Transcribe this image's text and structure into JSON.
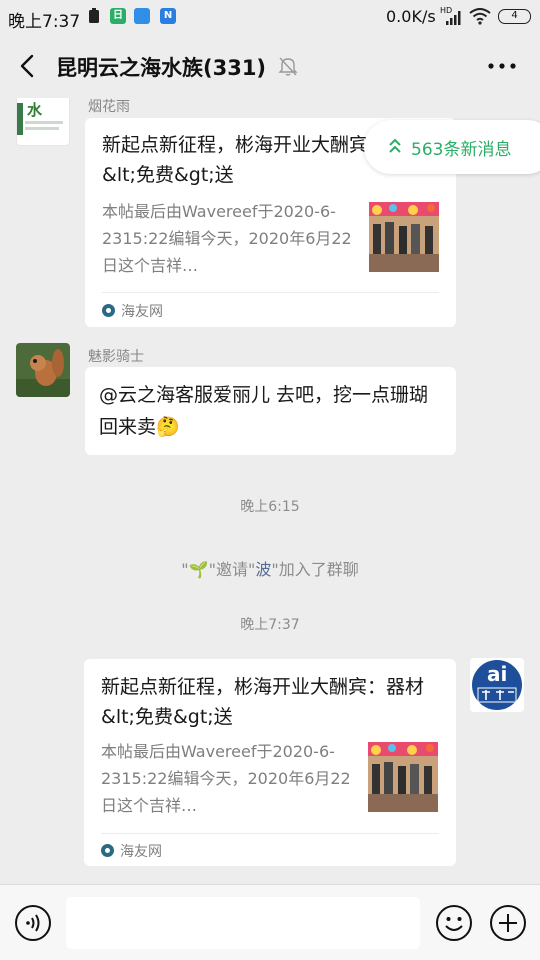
{
  "status_bar": {
    "time": "晚上7:37",
    "network_speed": "0.0K/s",
    "hd_label": "HD",
    "battery": "4",
    "app_icon_labels": [
      "",
      "日",
      "",
      "N"
    ]
  },
  "header": {
    "title": "昆明云之海水族(331)"
  },
  "new_messages": {
    "label": "563条新消息"
  },
  "messages": [
    {
      "sender": "烟花雨",
      "avatar_glyph": "水",
      "card_title": "新起点新征程，彬海开业大酬宾：器材&lt;免费&gt;送",
      "card_desc": "本帖最后由Wavereef于2020-6-2315:22编辑今天，2020年6月22日这个吉祥…",
      "source": "海友网"
    },
    {
      "sender": "魅影骑士",
      "text": "@云之海客服爱丽儿  去吧，挖一点珊瑚回来卖🤔"
    },
    {
      "card_title": "新起点新征程，彬海开业大酬宾：器材&lt;免费&gt;送",
      "card_desc": "本帖最后由Wavereef于2020-6-2315:22编辑今天，2020年6月22日这个吉祥…",
      "source": "海友网",
      "avatar_glyph": "ai"
    }
  ],
  "time_dividers": [
    "晚上6:15",
    "晚上7:37"
  ],
  "system_message": {
    "prefix": "\"",
    "emoji": "🌱",
    "middle": "\"邀请\"",
    "name": "波",
    "suffix": "\"加入了群聊"
  },
  "colors": {
    "accent_green": "#2aae67",
    "link_blue": "#576b95",
    "background": "#ededed"
  },
  "icons": [
    "back-icon",
    "mute-bell-icon",
    "more-icon",
    "chevron-up-icon",
    "voice-icon",
    "emoji-icon",
    "plus-icon"
  ]
}
